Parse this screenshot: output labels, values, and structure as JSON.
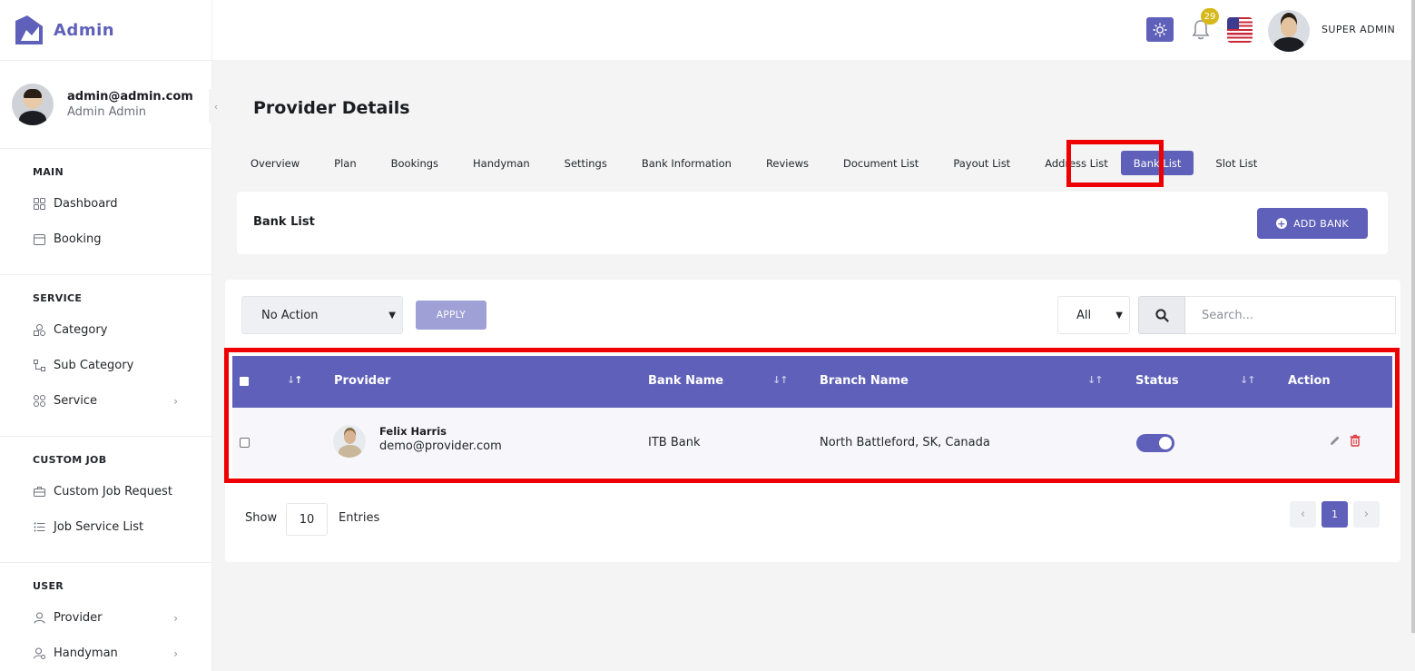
{
  "brand": {
    "name": "Admin",
    "accent": "#5f60b9"
  },
  "user": {
    "email": "admin@admin.com",
    "name": "Admin Admin"
  },
  "header": {
    "notification_count": "29",
    "admin_label": "SUPER ADMIN"
  },
  "sidebar": {
    "sections": [
      {
        "heading": "MAIN",
        "items": [
          {
            "label": "Dashboard",
            "icon": "grid-icon"
          },
          {
            "label": "Booking",
            "icon": "calendar-icon"
          }
        ]
      },
      {
        "heading": "SERVICE",
        "items": [
          {
            "label": "Category",
            "icon": "shapes-icon"
          },
          {
            "label": "Sub Category",
            "icon": "branch-icon"
          },
          {
            "label": "Service",
            "icon": "grid-icon",
            "arrow": true
          }
        ]
      },
      {
        "heading": "CUSTOM JOB",
        "items": [
          {
            "label": "Custom Job Request",
            "icon": "briefcase-icon"
          },
          {
            "label": "Job Service List",
            "icon": "list-icon"
          }
        ]
      },
      {
        "heading": "USER",
        "items": [
          {
            "label": "Provider",
            "icon": "user-icon",
            "arrow": true
          },
          {
            "label": "Handyman",
            "icon": "user-gear-icon",
            "arrow": true
          }
        ]
      }
    ]
  },
  "page": {
    "title": "Provider Details",
    "tabs": [
      "Overview",
      "Plan",
      "Bookings",
      "Handyman",
      "Settings",
      "Bank Information",
      "Reviews",
      "Document List",
      "Payout List",
      "Address List",
      "Bank List",
      "Slot List"
    ],
    "active_tab": "Bank List"
  },
  "bank_card": {
    "title": "Bank List",
    "add_button": "ADD BANK"
  },
  "table_controls": {
    "bulk_action": "No Action",
    "apply_label": "APPLY",
    "filter_value": "All",
    "search_placeholder": "Search..."
  },
  "table": {
    "columns": [
      "Provider",
      "Bank Name",
      "Branch Name",
      "Status",
      "Action"
    ],
    "rows": [
      {
        "provider_name": "Felix Harris",
        "provider_email": "demo@provider.com",
        "bank_name": "ITB Bank",
        "branch_name": "North Battleford, SK, Canada",
        "status": true
      }
    ]
  },
  "footer": {
    "show_label": "Show",
    "entries_value": "10",
    "entries_label": "Entries",
    "current_page": "1"
  }
}
